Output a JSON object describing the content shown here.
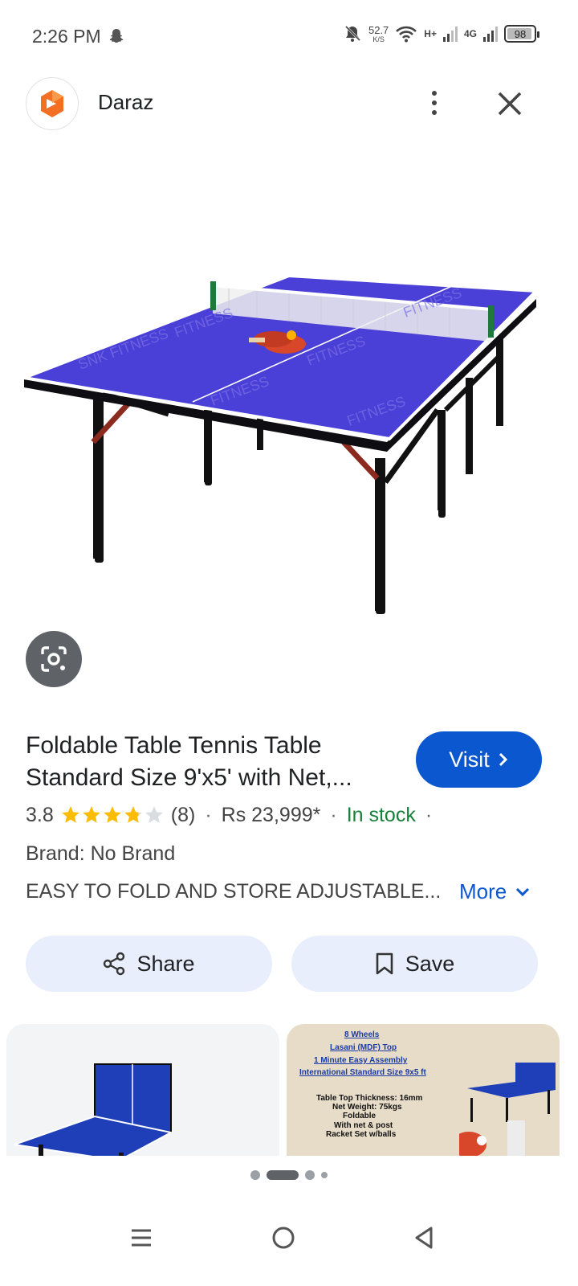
{
  "status_bar": {
    "time": "2:26 PM",
    "net_speed": "52.7",
    "net_speed_unit": "K/S",
    "signal_1_label": "H+",
    "signal_2_label": "4G",
    "battery": "98",
    "icons": [
      "snapchat-icon",
      "mute-bell-icon",
      "wifi-icon",
      "signal-icon",
      "battery-icon"
    ]
  },
  "header": {
    "site_name": "Daraz",
    "icons": [
      "daraz-logo-icon",
      "more-vert-icon",
      "close-icon"
    ]
  },
  "product": {
    "title": "Foldable Table Tennis Table Standard Size 9'x5' with Net,...",
    "visit_label": "Visit",
    "rating": "3.8",
    "rating_value": 3.8,
    "review_count": "(8)",
    "price": "Rs 23,999*",
    "stock": "In stock",
    "separator": "·",
    "brand": "Brand: No Brand",
    "description": "EASY TO FOLD AND STORE ADJUSTABLE...",
    "more_label": "More"
  },
  "actions": {
    "share_label": "Share",
    "save_label": "Save"
  },
  "thumbnail_2": {
    "lines": [
      "8 Wheels",
      "Lasani (MDF) Top",
      "1 Minute Easy Assembly",
      "International Standard Size 9x5 ft"
    ],
    "specs": [
      "Table Top Thickness: 16mm",
      "Net Weight: 75kgs",
      "Foldable",
      "With net & post",
      "Racket Set w/balls"
    ]
  },
  "colors": {
    "accent": "#0b57d0",
    "stock_green": "#188038",
    "star": "#fbbc04",
    "chip_bg": "#e8eefb",
    "table_blue": "#4a3fd6"
  },
  "pager": {
    "active_index": 1,
    "count": 4
  }
}
